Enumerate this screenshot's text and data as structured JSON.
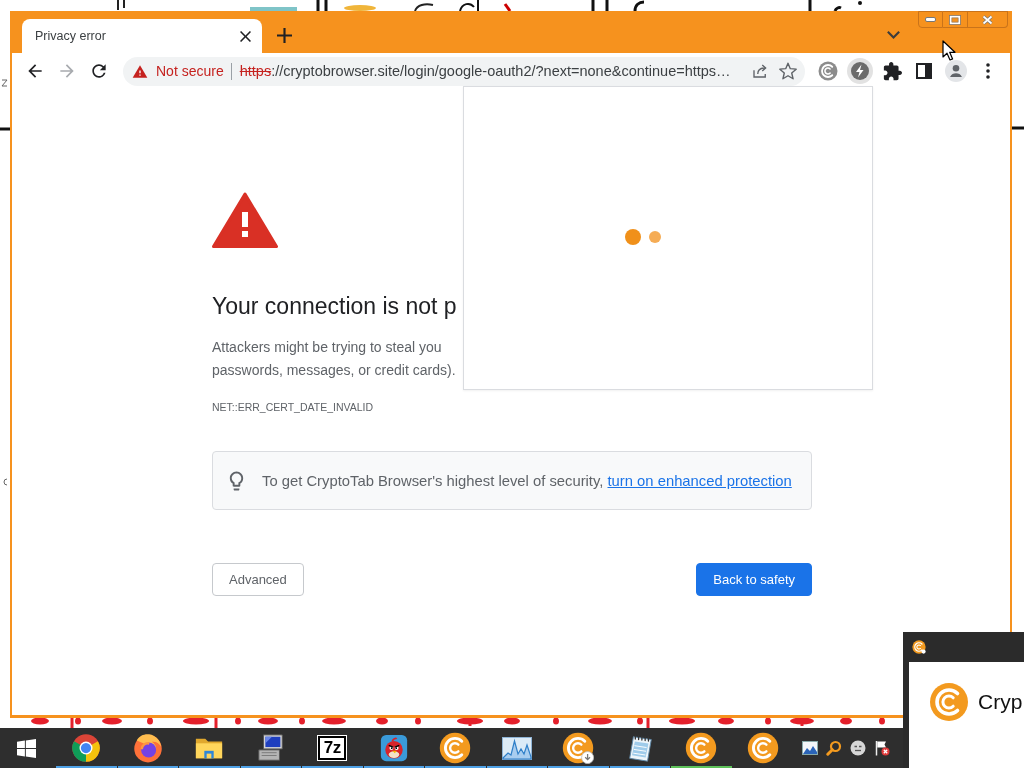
{
  "browser": {
    "tabs": [
      {
        "title": "Privacy error",
        "selected": true
      }
    ],
    "nav_buttons": [
      {
        "kind": "back",
        "disabled": false
      },
      {
        "kind": "forward",
        "disabled": true
      },
      {
        "kind": "reload",
        "disabled": false
      }
    ],
    "address_bar": {
      "security_label": "Not secure",
      "url_scheme": "https",
      "url_rest": "://cryptobrowser.site/login/google-oauth2/?next=none&continue=https…"
    }
  },
  "error_page": {
    "heading": "Your connection is not p",
    "body_lines": [
      "Attackers might be trying to steal you",
      "passwords, messages, or credit cards)."
    ],
    "error_code": "NET::ERR_CERT_DATE_INVALID",
    "tip": {
      "text": "To get CryptoTab Browser's highest level of security, ",
      "link": "turn on enhanced protection"
    },
    "buttons": [
      {
        "kind": "secondary",
        "label": "Advanced"
      },
      {
        "kind": "primary",
        "label": "Back to safety"
      }
    ]
  },
  "extension_popup": {
    "loading": true
  },
  "taskbar": {
    "apps": [
      {
        "kind": "chrome",
        "running": true,
        "selected": false
      },
      {
        "kind": "firefox",
        "running": true,
        "selected": false
      },
      {
        "kind": "folder",
        "running": true,
        "selected": false
      },
      {
        "kind": "computer",
        "running": true,
        "selected": false
      },
      {
        "kind": "sevenzip",
        "label": "7z",
        "running": true,
        "selected": false
      },
      {
        "kind": "bird",
        "running": true,
        "selected": false
      },
      {
        "kind": "cryptotab",
        "running": true,
        "selected": false
      },
      {
        "kind": "chart",
        "running": true,
        "selected": false
      },
      {
        "kind": "cryptotab_download",
        "running": true,
        "selected": false
      },
      {
        "kind": "notepad",
        "running": true,
        "selected": false
      },
      {
        "kind": "cryptotab",
        "running": true,
        "selected": true
      },
      {
        "kind": "cryptotab",
        "running": false,
        "selected": false
      }
    ]
  },
  "notification": {
    "title": "Cryp"
  }
}
